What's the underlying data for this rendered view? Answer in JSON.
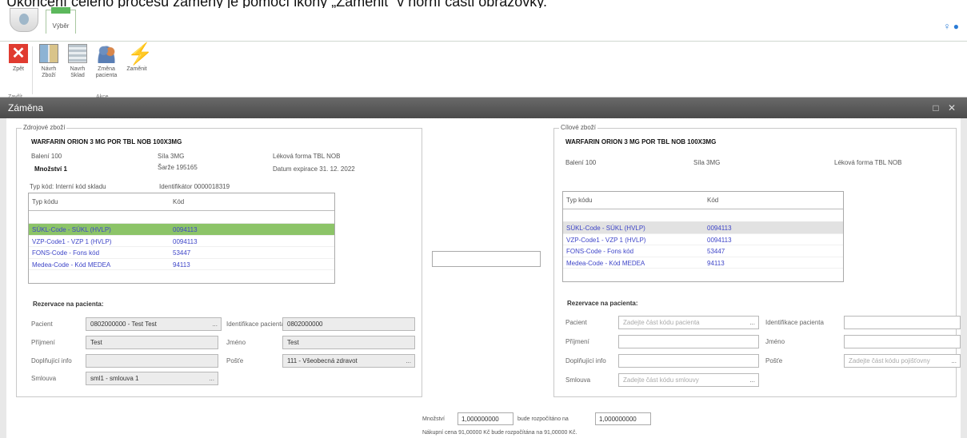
{
  "caption": "Ukončení celého procesu záměny je pomocí ikony „Zaměnit“ v horní části obrazovky.",
  "ribbon": {
    "tab": "Výběr",
    "buttons": [
      {
        "label": "Zpět",
        "icon": "close-icon"
      },
      {
        "label": "Návrh Zboží",
        "icon": "book-icon"
      },
      {
        "label": "Navrh Sklad",
        "icon": "shelf-icon"
      },
      {
        "label": "Změna pacienta",
        "icon": "people-icon"
      },
      {
        "label": "Zaměnit",
        "icon": "lightning-icon"
      }
    ],
    "groups": [
      "Zavřít",
      "Akce"
    ]
  },
  "dialog": {
    "title": "Záměna"
  },
  "source": {
    "legend": "Zdrojové zboží",
    "product": "WARFARIN ORION 3 MG   POR TBL NOB 100X3MG",
    "baleni": "Balení 100",
    "sila": "Síla 3MG",
    "lekova_forma": "Léková forma TBL NOB",
    "mnozstvi": "Množství  1",
    "sarze": "Šarže 195165",
    "expirace": "Datum expirace 31. 12. 2022",
    "typ_kodu": "Typ kód: Interní kód skladu",
    "identifikator": "Identifikátor 0000018319",
    "grid_headers": [
      "Typ kódu",
      "Kód"
    ],
    "rows": [
      {
        "typ": "SÚKL-Code - SÚKL (HVLP)",
        "kod": "0094113"
      },
      {
        "typ": "VZP-Code1 - VZP 1 (HVLP)",
        "kod": "0094113"
      },
      {
        "typ": "FONS-Code - Fons kód",
        "kod": "53447"
      },
      {
        "typ": "Medea-Code - Kód MEDEA",
        "kod": "94113"
      }
    ],
    "reservation_title": "Rezervace na pacienta:",
    "pacient_label": "Pacient",
    "pacient_value": "0802000000 - Test Test",
    "ident_label": "Identifikace pacienta",
    "ident_value": "0802000000",
    "prijmeni_label": "Příjmení",
    "prijmeni_value": "Test",
    "jmeno_label": "Jméno",
    "jmeno_value": "Test",
    "doplnujici_label": "Doplňující info",
    "doplnujici_value": "",
    "pojistovna_label": "Pošťe",
    "pojistovna_value": "111 - Všeobecná zdravot",
    "smlouva_label": "Smlouva",
    "smlouva_value": "sml1 - smlouva 1"
  },
  "target": {
    "legend": "Cílové zboží",
    "product": "WARFARIN ORION 3 MG   POR TBL NOB 100X3MG",
    "baleni": "Balení 100",
    "sila": "Síla 3MG",
    "lekova_forma": "Léková forma TBL NOB",
    "grid_headers": [
      "Typ kódu",
      "Kód"
    ],
    "rows": [
      {
        "typ": "SÚKL-Code - SÚKL (HVLP)",
        "kod": "0094113"
      },
      {
        "typ": "VZP-Code1 - VZP 1 (HVLP)",
        "kod": "0094113"
      },
      {
        "typ": "FONS-Code - Fons kód",
        "kod": "53447"
      },
      {
        "typ": "Medea-Code - Kód MEDEA",
        "kod": "94113"
      }
    ],
    "reservation_title": "Rezervace na pacienta:",
    "pacient_label": "Pacient",
    "pacient_placeholder": "Zadejte část kódu pacienta",
    "ident_label": "Identifikace pacienta",
    "prijmeni_label": "Příjmení",
    "jmeno_label": "Jméno",
    "doplnujici_label": "Doplňující info",
    "pojistovna_label": "Pošťe",
    "pojistovna_placeholder": "Zadejte část kódu pojišťovny",
    "smlouva_label": "Smlouva",
    "smlouva_placeholder": "Zadejte část kódu smlouvy"
  },
  "footer": {
    "mnozstvi_label": "Množství",
    "mnozstvi_value": "1,000000000",
    "rozpocitano_label": "bude rozpočítáno na",
    "rozpocitano_value": "1,000000000",
    "price_text": "Nákupní cena 91,00000 Kč bude rozpočítána na 91,00000 Kč."
  }
}
